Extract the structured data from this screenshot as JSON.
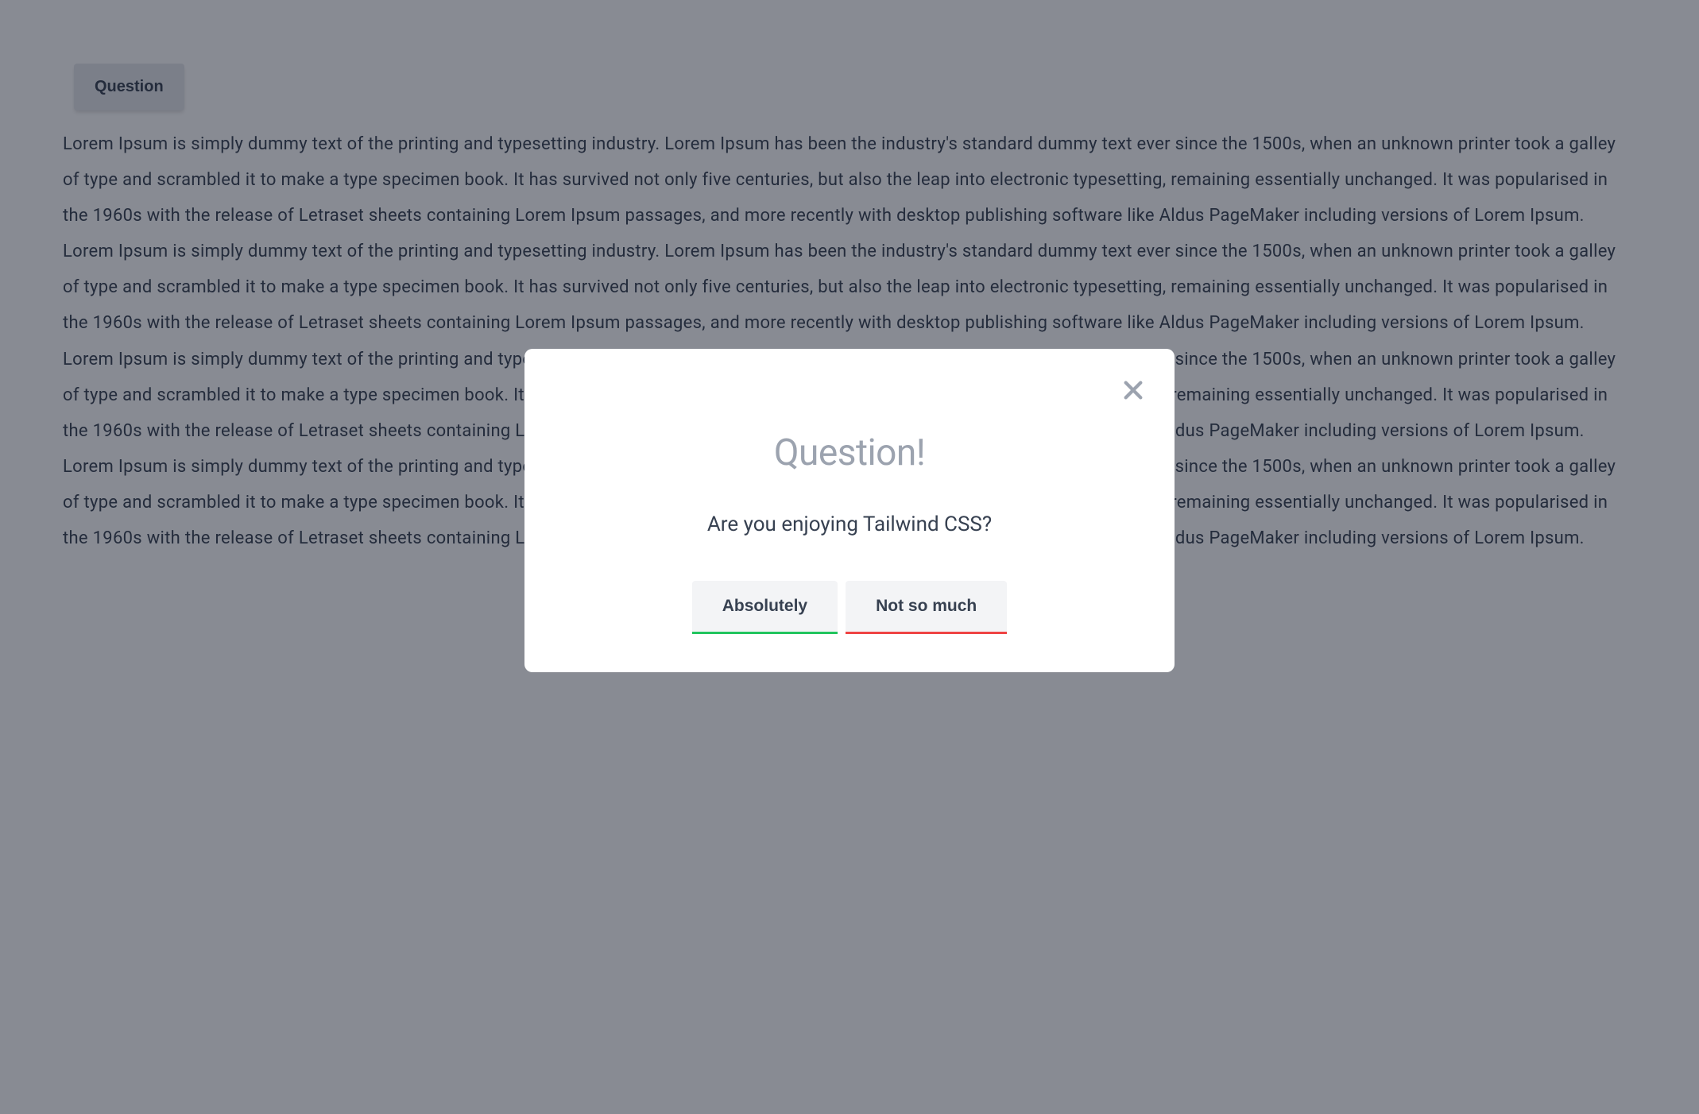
{
  "page": {
    "trigger_button_label": "Question",
    "body_text": "Lorem Ipsum is simply dummy text of the printing and typesetting industry. Lorem Ipsum has been the industry's standard dummy text ever since the 1500s, when an unknown printer took a galley of type and scrambled it to make a type specimen book. It has survived not only five centuries, but also the leap into electronic typesetting, remaining essentially unchanged. It was popularised in the 1960s with the release of Letraset sheets containing Lorem Ipsum passages, and more recently with desktop publishing software like Aldus PageMaker including versions of Lorem Ipsum. Lorem Ipsum is simply dummy text of the printing and typesetting industry. Lorem Ipsum has been the industry's standard dummy text ever since the 1500s, when an unknown printer took a galley of type and scrambled it to make a type specimen book. It has survived not only five centuries, but also the leap into electronic typesetting, remaining essentially unchanged. It was popularised in the 1960s with the release of Letraset sheets containing Lorem Ipsum passages, and more recently with desktop publishing software like Aldus PageMaker including versions of Lorem Ipsum. Lorem Ipsum is simply dummy text of the printing and typesetting industry. Lorem Ipsum has been the industry's standard dummy text ever since the 1500s, when an unknown printer took a galley of type and scrambled it to make a type specimen book. It has survived not only five centuries, but also the leap into electronic typesetting, remaining essentially unchanged. It was popularised in the 1960s with the release of Letraset sheets containing Lorem Ipsum passages, and more recently with desktop publishing software like Aldus PageMaker including versions of Lorem Ipsum. Lorem Ipsum is simply dummy text of the printing and typesetting industry. Lorem Ipsum has been the industry's standard dummy text ever since the 1500s, when an unknown printer took a galley of type and scrambled it to make a type specimen book. It has survived not only five centuries, but also the leap into electronic typesetting, remaining essentially unchanged. It was popularised in the 1960s with the release of Letraset sheets containing Lorem Ipsum passages, and more recently with desktop publishing software like Aldus PageMaker including versions of Lorem Ipsum."
  },
  "modal": {
    "title": "Question!",
    "subtitle": "Are you enjoying Tailwind CSS?",
    "positive_label": "Absolutely",
    "negative_label": "Not so much"
  },
  "colors": {
    "overlay": "rgba(17,24,39,0.5)",
    "positive_accent": "#22c55e",
    "negative_accent": "#ef4444"
  }
}
